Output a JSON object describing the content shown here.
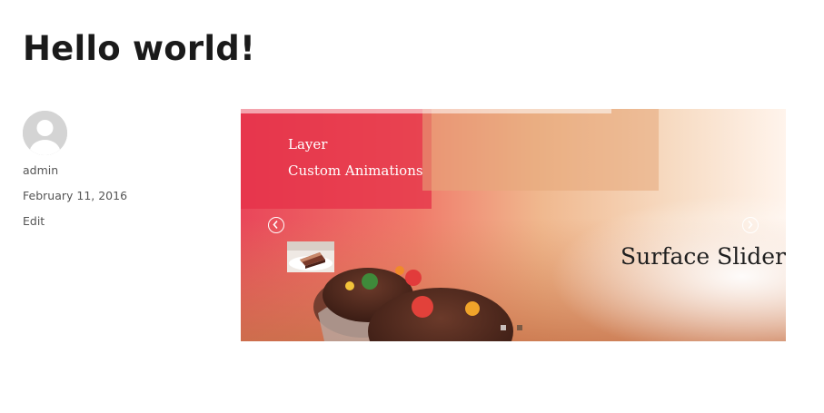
{
  "post": {
    "title": "Hello world!",
    "author": "admin",
    "date": "February 11, 2016",
    "edit_label": "Edit"
  },
  "slider": {
    "layers": [
      "Layer",
      "Custom Animations"
    ],
    "caption": "Surface Slider",
    "prev_icon": "chevron-left-circle-icon",
    "next_icon": "chevron-right-circle-icon",
    "progress": 0.68,
    "bullets": 2,
    "active_bullet": 2
  },
  "colors": {
    "title": "#1a1a1a",
    "meta": "#555555",
    "slider_red": "#e8334a",
    "caption": "#1f1f1f"
  }
}
